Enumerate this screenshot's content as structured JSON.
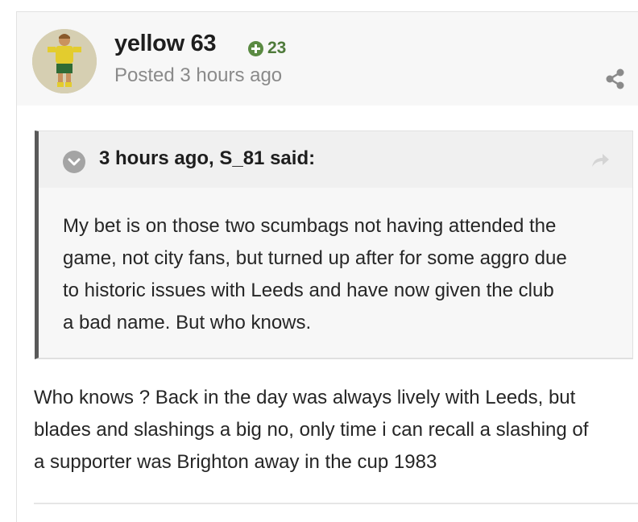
{
  "post": {
    "author": "yellow 63",
    "reputation": "23",
    "posted": "Posted 3 hours ago"
  },
  "quote": {
    "citation": "3 hours ago, S_81 said:",
    "lines": [
      "My bet is on those two scumbags not having attended the",
      "game, not city fans, but turned up after for some aggro due",
      "to historic issues with Leeds and have now given the club",
      "a bad name. But who knows."
    ]
  },
  "reply": {
    "lines": [
      "Who knows ? Back in the day was always lively with Leeds, but",
      "blades and slashings a big no, only time i can recall a slashing of",
      "a supporter was Brighton away in the cup 1983"
    ]
  },
  "icons": {
    "reputation": "plus-circle-icon",
    "share": "share-icon",
    "collapse": "chevron-down-icon",
    "goto": "reply-arrow-icon"
  },
  "colors": {
    "reputation": "#4e7a3a",
    "quote_border": "#595959",
    "muted": "#8a8a8a"
  }
}
